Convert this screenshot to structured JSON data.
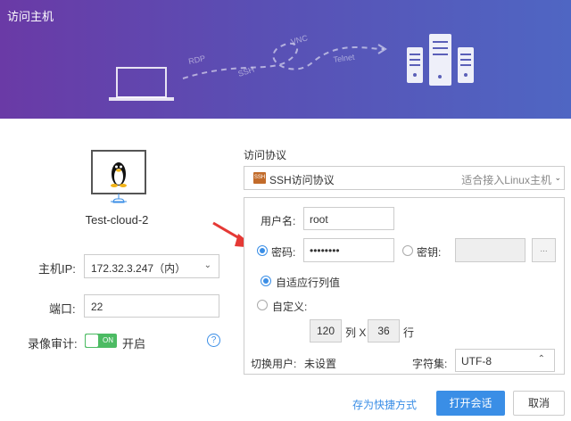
{
  "window": {
    "title": "访问主机"
  },
  "banner": {
    "labels": [
      "RDP",
      "SSH",
      "VNC",
      "Telnet"
    ]
  },
  "host": {
    "name": "Test-cloud-2",
    "icon": "linux-penguin-icon"
  },
  "fields": {
    "ip_label": "主机IP:",
    "ip_value": "172.32.3.247（内）",
    "port_label": "端口:",
    "port_value": "22",
    "audit_label": "录像审计:",
    "audit_toggle_text": "ON",
    "audit_state_text": "开启",
    "help": "?"
  },
  "protocol": {
    "label": "访问协议",
    "icon_text": "SSH",
    "selected": "SSH访问协议",
    "hint": "适合接入Linux主机"
  },
  "auth": {
    "username_label": "用户名:",
    "username_value": "root",
    "password_label": "密码:",
    "password_value": "••••••••",
    "key_label": "密钥:",
    "key_browse": "...",
    "adaptive_label": "自适应行列值",
    "custom_label": "自定义:",
    "cols_value": "120",
    "cols_unit": "列 X",
    "rows_value": "36",
    "rows_unit": "行",
    "switch_user_label": "切换用户:",
    "switch_user_link": "未设置",
    "charset_label": "字符集:",
    "charset_value": "UTF-8"
  },
  "footer": {
    "shortcut_link": "存为快捷方式",
    "open_button": "打开会话",
    "cancel_button": "取消"
  },
  "colors": {
    "accent": "#3a8ee6",
    "toggle_on": "#4cbb63",
    "banner_start": "#6a3aa6",
    "banner_end": "#4f66c3"
  }
}
